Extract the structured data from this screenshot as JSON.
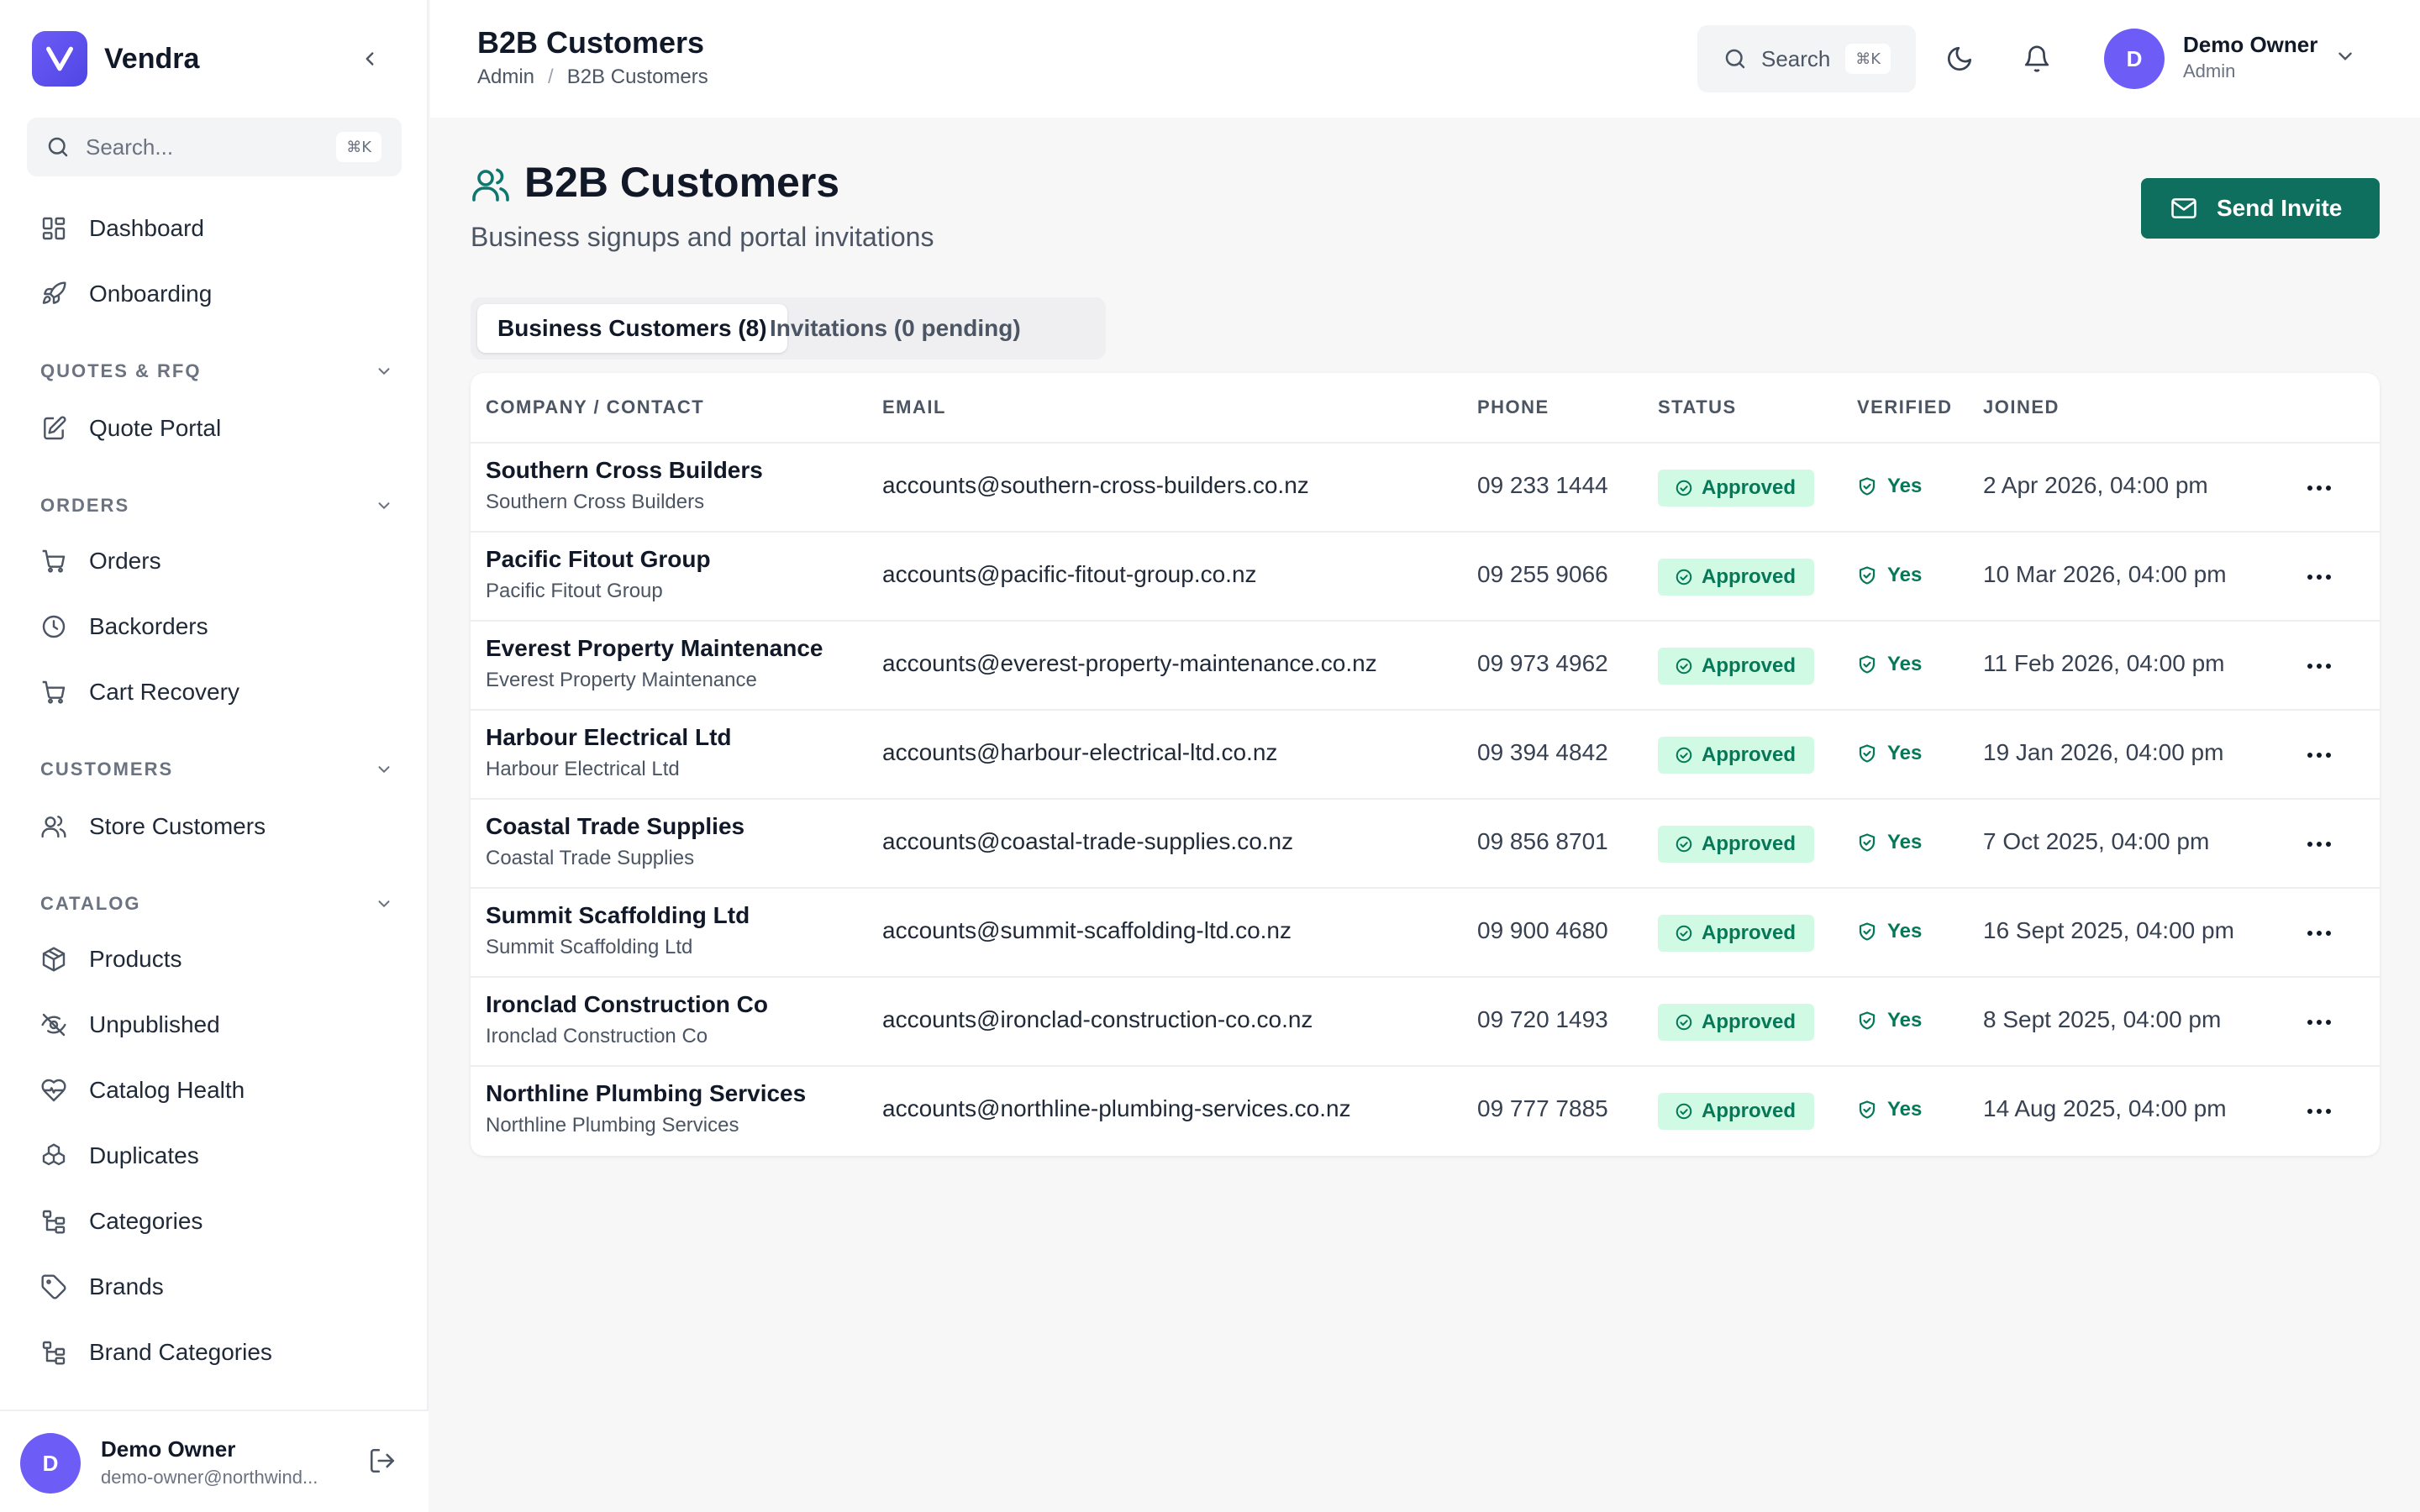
{
  "app": {
    "name": "Vendra",
    "colors": {
      "brand": "#5b4ff0",
      "accent": "#0f6f5f",
      "approved_bg": "#d1fae5",
      "approved_fg": "#047857"
    }
  },
  "sidebar": {
    "search_placeholder": "Search...",
    "search_shortcut": "⌘K",
    "items": [
      {
        "label": "Dashboard",
        "icon": "dashboard-icon"
      },
      {
        "label": "Onboarding",
        "icon": "rocket-icon"
      }
    ],
    "sections": [
      {
        "title": "QUOTES & RFQ",
        "items": [
          {
            "label": "Quote Portal",
            "icon": "edit-document-icon"
          }
        ]
      },
      {
        "title": "ORDERS",
        "items": [
          {
            "label": "Orders",
            "icon": "cart-icon"
          },
          {
            "label": "Backorders",
            "icon": "clock-icon"
          },
          {
            "label": "Cart Recovery",
            "icon": "cart-icon"
          }
        ]
      },
      {
        "title": "CUSTOMERS",
        "items": [
          {
            "label": "Store Customers",
            "icon": "users-icon"
          }
        ]
      },
      {
        "title": "CATALOG",
        "items": [
          {
            "label": "Products",
            "icon": "package-icon"
          },
          {
            "label": "Unpublished",
            "icon": "eye-off-icon"
          },
          {
            "label": "Catalog Health",
            "icon": "heart-pulse-icon"
          },
          {
            "label": "Duplicates",
            "icon": "boxes-icon"
          },
          {
            "label": "Categories",
            "icon": "hierarchy-icon"
          },
          {
            "label": "Brands",
            "icon": "tag-icon"
          },
          {
            "label": "Brand Categories",
            "icon": "hierarchy-icon"
          }
        ]
      }
    ],
    "footer": {
      "initial": "D",
      "name": "Demo Owner",
      "email": "demo-owner@northwind..."
    }
  },
  "topbar": {
    "title": "B2B Customers",
    "breadcrumb": [
      "Admin",
      "B2B Customers"
    ],
    "search_label": "Search",
    "search_shortcut": "⌘K",
    "user": {
      "initial": "D",
      "name": "Demo Owner",
      "role": "Admin"
    }
  },
  "page": {
    "title": "B2B Customers",
    "subtitle": "Business signups and portal invitations",
    "invite_button": "Send Invite",
    "tabs": [
      {
        "label": "Business Customers (8)",
        "active": true
      },
      {
        "label": "Invitations (0 pending)",
        "active": false
      }
    ]
  },
  "table": {
    "columns": [
      "COMPANY / CONTACT",
      "EMAIL",
      "PHONE",
      "STATUS",
      "VERIFIED",
      "JOINED"
    ],
    "rows": [
      {
        "company": "Southern Cross Builders",
        "contact": "Southern Cross Builders",
        "email": "accounts@southern-cross-builders.co.nz",
        "phone": "09 233 1444",
        "status": "Approved",
        "verified": "Yes",
        "joined": "2 Apr 2026, 04:00 pm"
      },
      {
        "company": "Pacific Fitout Group",
        "contact": "Pacific Fitout Group",
        "email": "accounts@pacific-fitout-group.co.nz",
        "phone": "09 255 9066",
        "status": "Approved",
        "verified": "Yes",
        "joined": "10 Mar 2026, 04:00 pm"
      },
      {
        "company": "Everest Property Maintenance",
        "contact": "Everest Property Maintenance",
        "email": "accounts@everest-property-maintenance.co.nz",
        "phone": "09 973 4962",
        "status": "Approved",
        "verified": "Yes",
        "joined": "11 Feb 2026, 04:00 pm"
      },
      {
        "company": "Harbour Electrical Ltd",
        "contact": "Harbour Electrical Ltd",
        "email": "accounts@harbour-electrical-ltd.co.nz",
        "phone": "09 394 4842",
        "status": "Approved",
        "verified": "Yes",
        "joined": "19 Jan 2026, 04:00 pm"
      },
      {
        "company": "Coastal Trade Supplies",
        "contact": "Coastal Trade Supplies",
        "email": "accounts@coastal-trade-supplies.co.nz",
        "phone": "09 856 8701",
        "status": "Approved",
        "verified": "Yes",
        "joined": "7 Oct 2025, 04:00 pm"
      },
      {
        "company": "Summit Scaffolding Ltd",
        "contact": "Summit Scaffolding Ltd",
        "email": "accounts@summit-scaffolding-ltd.co.nz",
        "phone": "09 900 4680",
        "status": "Approved",
        "verified": "Yes",
        "joined": "16 Sept 2025, 04:00 pm"
      },
      {
        "company": "Ironclad Construction Co",
        "contact": "Ironclad Construction Co",
        "email": "accounts@ironclad-construction-co.co.nz",
        "phone": "09 720 1493",
        "status": "Approved",
        "verified": "Yes",
        "joined": "8 Sept 2025, 04:00 pm"
      },
      {
        "company": "Northline Plumbing Services",
        "contact": "Northline Plumbing Services",
        "email": "accounts@northline-plumbing-services.co.nz",
        "phone": "09 777 7885",
        "status": "Approved",
        "verified": "Yes",
        "joined": "14 Aug 2025, 04:00 pm"
      }
    ]
  }
}
